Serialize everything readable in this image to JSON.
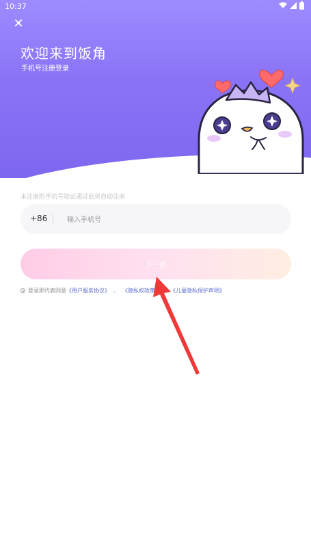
{
  "status_bar": {
    "time": "10:37",
    "icons": [
      "wifi-icon",
      "signal-icon",
      "battery-icon"
    ]
  },
  "header": {
    "close_icon": "close-icon",
    "close_glyph": "✕",
    "title": "欢迎来到饭角",
    "subtitle": "手机号注册登录"
  },
  "form": {
    "hint": "未注册的手机号验证通过后将自动注册",
    "country_code": "+86",
    "phone_placeholder": "输入手机号",
    "phone_value": "",
    "next_label": "下一步"
  },
  "agreement": {
    "prefix": "登录即代表同意",
    "user_agreement": "《用户服务协议》",
    "sep1": "、",
    "privacy_policy": "《隐私权政策》",
    "sep2": "和",
    "child_privacy": "《儿童隐私保护声明》"
  },
  "colors": {
    "header_gradient_start": "#9d8cff",
    "header_gradient_end": "#7e67ef",
    "button_gradient_start": "#ffcde6",
    "button_gradient_end": "#ffeee2",
    "link": "#5f6fd1",
    "annotation_arrow": "#f03a3a"
  }
}
